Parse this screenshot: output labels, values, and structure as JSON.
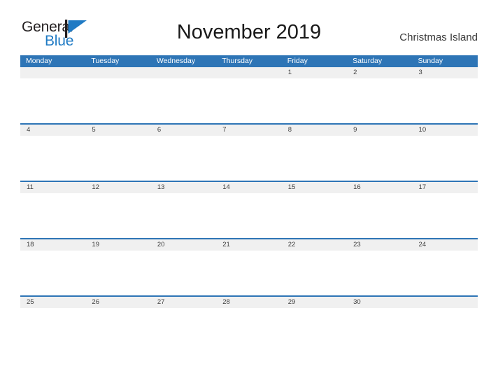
{
  "brand": {
    "name_part1": "General",
    "name_part2": "Blue",
    "flag_icon": "blue-flag-triangle",
    "accent_color": "#1f7ac4"
  },
  "header": {
    "title": "November 2019",
    "location": "Christmas Island"
  },
  "colors": {
    "header_blue": "#2E75B6",
    "band_gray": "#F0F0F0",
    "separator_blue": "#2E75B6",
    "date_text": "#3c3c3c",
    "title_text": "#1a1a1a"
  },
  "calendar": {
    "month": "November",
    "year": "2019",
    "weekday_headers": [
      "Monday",
      "Tuesday",
      "Wednesday",
      "Thursday",
      "Friday",
      "Saturday",
      "Sunday"
    ],
    "weeks": [
      {
        "days": [
          "",
          "",
          "",
          "",
          "1",
          "2",
          "3"
        ]
      },
      {
        "days": [
          "4",
          "5",
          "6",
          "7",
          "8",
          "9",
          "10"
        ]
      },
      {
        "days": [
          "11",
          "12",
          "13",
          "14",
          "15",
          "16",
          "17"
        ]
      },
      {
        "days": [
          "18",
          "19",
          "20",
          "21",
          "22",
          "23",
          "24"
        ]
      },
      {
        "days": [
          "25",
          "26",
          "27",
          "28",
          "29",
          "30",
          ""
        ]
      }
    ]
  }
}
